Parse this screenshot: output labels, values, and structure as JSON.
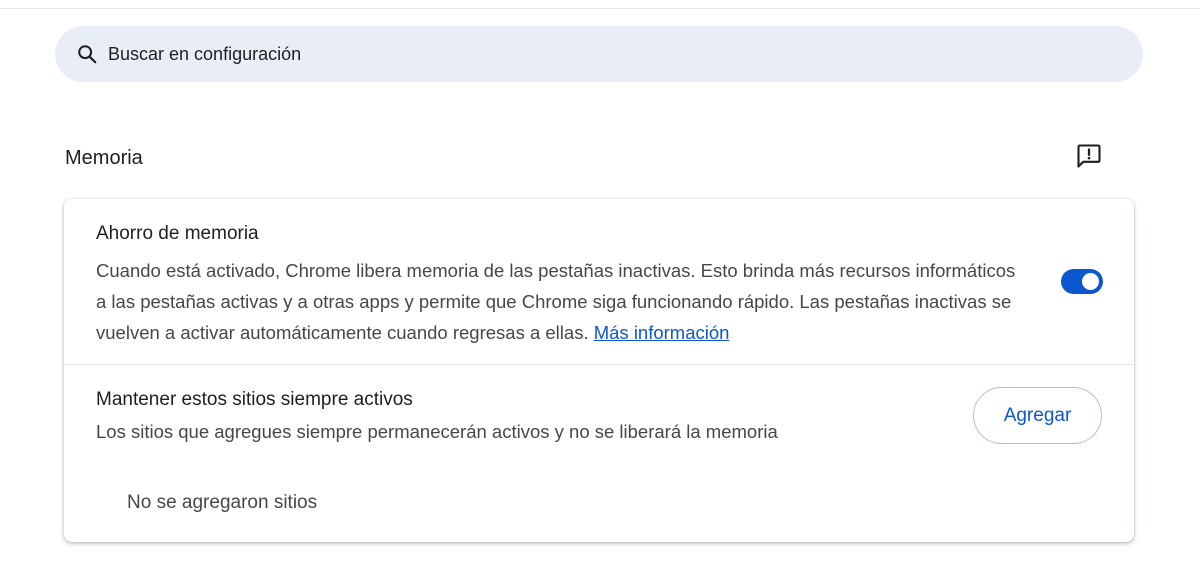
{
  "search": {
    "placeholder": "Buscar en configuración"
  },
  "section": {
    "title": "Memoria"
  },
  "memory_saver": {
    "title": "Ahorro de memoria",
    "description": "Cuando está activado, Chrome libera memoria de las pestañas inactivas. Esto brinda más recursos informáticos a las pestañas activas y a otras apps y permite que Chrome siga funcionando rápido. Las pestañas inactivas se vuelven a activar automáticamente cuando regresas a ellas.",
    "learn_more": "Más información",
    "enabled": true
  },
  "always_active": {
    "title": "Mantener estos sitios siempre activos",
    "description": "Los sitios que agregues siempre permanecerán activos y no se liberará la memoria",
    "add_label": "Agregar",
    "empty_text": "No se agregaron sitios"
  },
  "colors": {
    "accent": "#0b57d0",
    "search_bg": "#e9eef6"
  }
}
